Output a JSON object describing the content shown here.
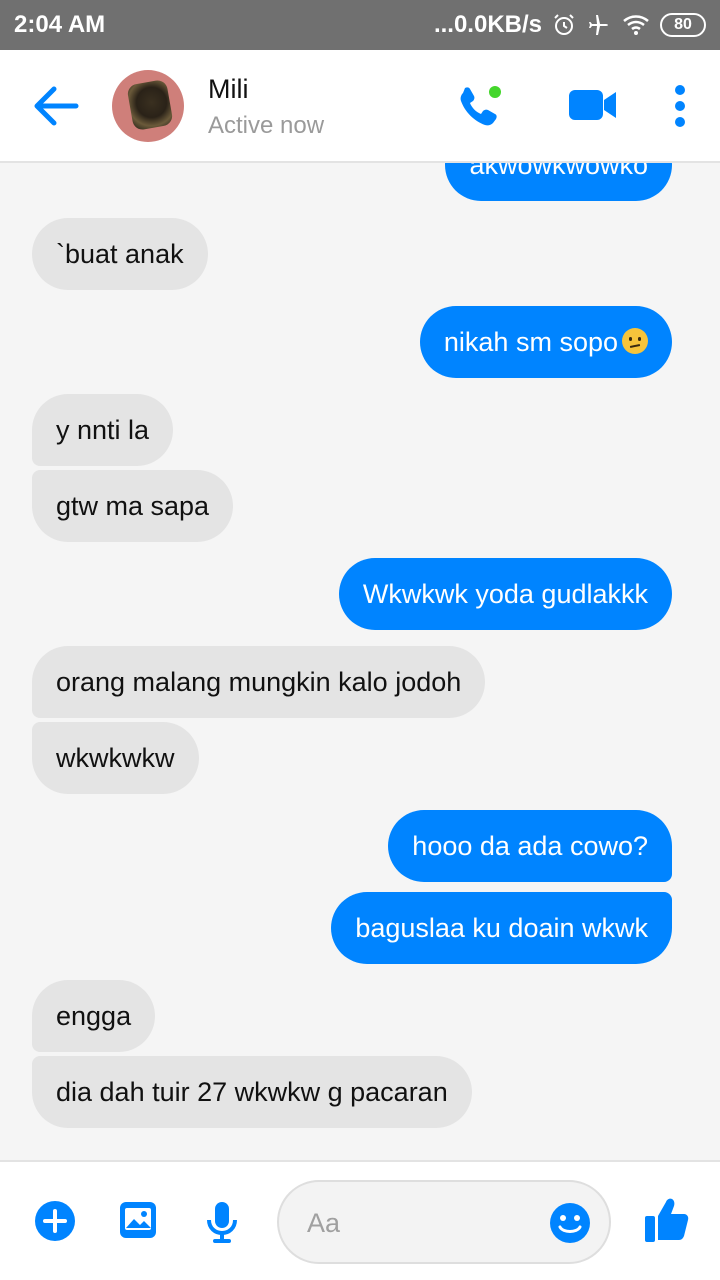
{
  "status_bar": {
    "time": "2:04 AM",
    "network": "...0.0KB/s",
    "battery": "80"
  },
  "header": {
    "contact_name": "Mili",
    "status": "Active now"
  },
  "messages": [
    {
      "from": "me",
      "text": "akwowkwowko"
    },
    {
      "from": "them",
      "text": "`buat anak"
    },
    {
      "from": "me",
      "text": "nikah sm sopo",
      "emoji": "confused-face"
    },
    {
      "from": "them",
      "text": "y nnti la"
    },
    {
      "from": "them",
      "text": "gtw ma sapa"
    },
    {
      "from": "me",
      "text": "Wkwkwk yoda gudlakkk"
    },
    {
      "from": "them",
      "text": "orang malang mungkin kalo jodoh"
    },
    {
      "from": "them",
      "text": "wkwkwkw"
    },
    {
      "from": "me",
      "text": "hooo da ada cowo?"
    },
    {
      "from": "me",
      "text": "baguslaa ku doain wkwk"
    },
    {
      "from": "them",
      "text": "engga"
    },
    {
      "from": "them",
      "text": "dia dah tuir 27 wkwkw g pacaran"
    }
  ],
  "composer": {
    "placeholder": "Aa"
  },
  "colors": {
    "accent": "#0084ff",
    "incoming_bubble": "#e4e4e4",
    "online_dot": "#44d62c"
  },
  "icons": [
    "back-arrow-icon",
    "phone-icon",
    "video-camera-icon",
    "more-options-icon",
    "plus-icon",
    "image-icon",
    "microphone-icon",
    "emoji-icon",
    "thumbs-up-icon"
  ]
}
